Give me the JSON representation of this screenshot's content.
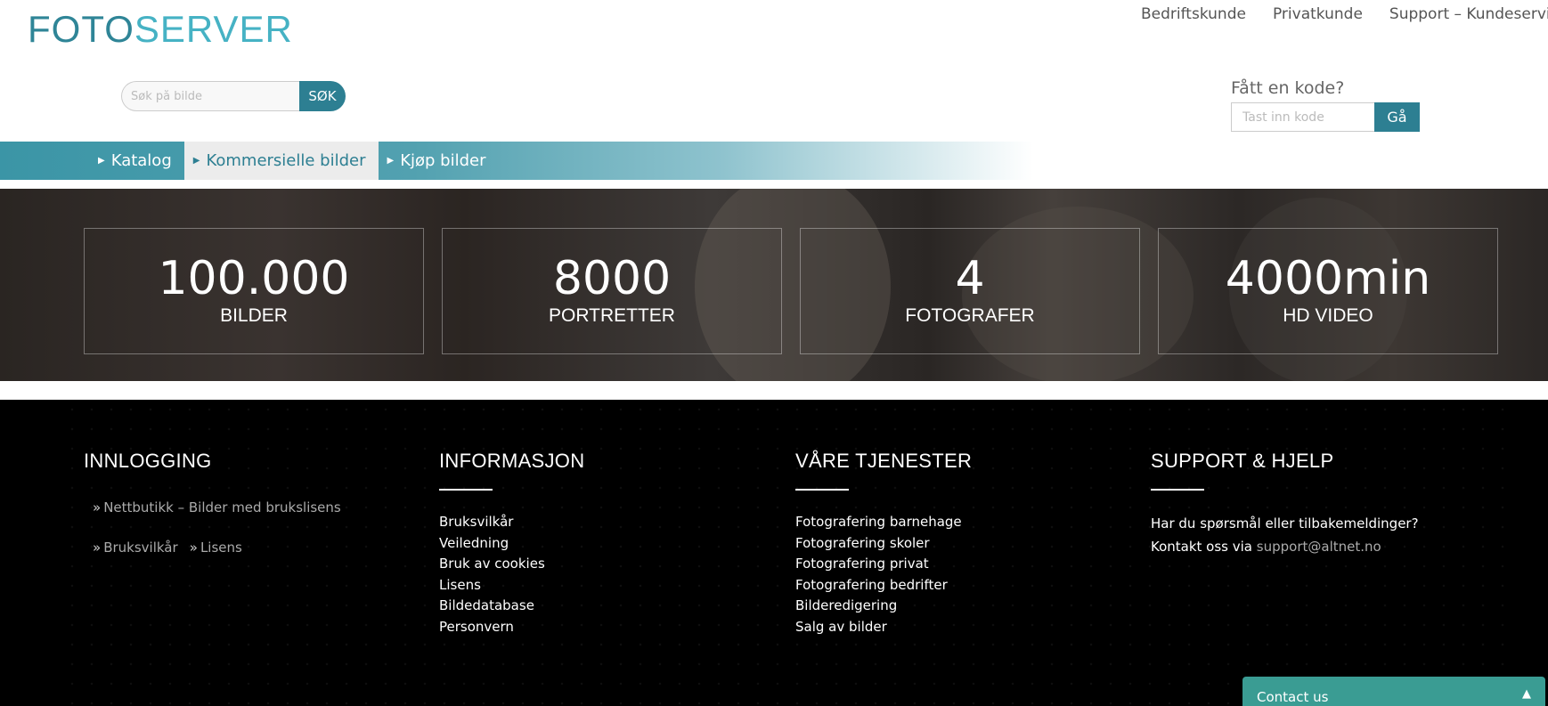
{
  "logo": {
    "part1": "FOTO",
    "part2": "SERVER"
  },
  "topnav": [
    "Bedriftskunde",
    "Privatkunde",
    "Support – Kundeservice"
  ],
  "search": {
    "placeholder": "Søk på bilde",
    "button": "SØK"
  },
  "code": {
    "label": "Fått en kode?",
    "placeholder": "Tast inn kode",
    "button": "Gå"
  },
  "menu": [
    "Katalog",
    "Kommersielle bilder",
    "Kjøp bilder"
  ],
  "stats": [
    {
      "num": "100.000",
      "label": "BILDER"
    },
    {
      "num": "8000",
      "label": "PORTRETTER"
    },
    {
      "num": "4",
      "label": "FOTOGRAFER"
    },
    {
      "num": "4000min",
      "label": "HD VIDEO"
    }
  ],
  "footer": {
    "login": {
      "title": "INNLOGGING",
      "link1": "Nettbutikk – Bilder med brukslisens",
      "link2": "Bruksvilkår",
      "link3": "Lisens"
    },
    "info": {
      "title": "INFORMASJON",
      "items": [
        "Bruksvilkår",
        "Veiledning",
        "Bruk av cookies",
        "Lisens",
        "Bildedatabase",
        "Personvern"
      ]
    },
    "services": {
      "title": "VÅRE TJENESTER",
      "items": [
        "Fotografering barnehage",
        "Fotografering skoler",
        "Fotografering privat",
        "Fotografering bedrifter",
        "Bilderedigering",
        "Salg av bilder"
      ]
    },
    "support": {
      "title": "SUPPORT & HJELP",
      "line1": "Har du spørsmål eller tilbakemeldinger?",
      "line2_prefix": "Kontakt oss via",
      "email": "support@altnet.no"
    }
  },
  "contact": {
    "label": "Contact us"
  },
  "colors": {
    "brand": "#2d7f92",
    "contact": "#3a9c93"
  }
}
